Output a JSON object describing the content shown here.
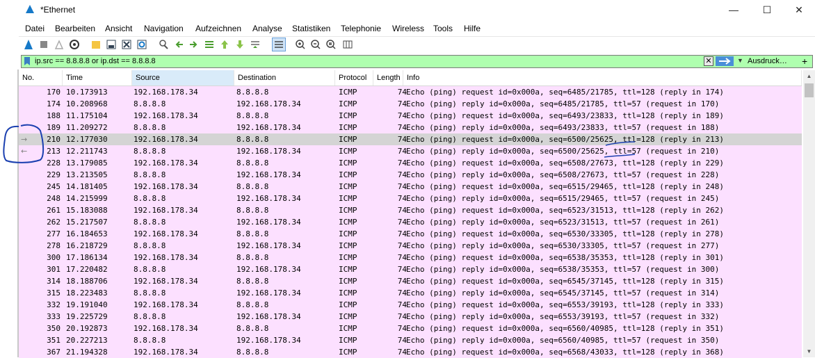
{
  "window": {
    "title": "*Ethernet"
  },
  "menu": [
    "Datei",
    "Bearbeiten",
    "Ansicht",
    "Navigation",
    "Aufzeichnen",
    "Analyse",
    "Statistiken",
    "Telephonie",
    "Wireless",
    "Tools",
    "Hilfe"
  ],
  "filter": {
    "expression": "ip.src == 8.8.8.8 or ip.dst == 8.8.8.8",
    "expression_button": "Ausdruck…",
    "plus": "+"
  },
  "columns": [
    "No.",
    "Time",
    "Source",
    "Destination",
    "Protocol",
    "Length",
    "Info"
  ],
  "selected_row": 4,
  "rows": [
    {
      "no": "170",
      "time": "10.173913",
      "src": "192.168.178.34",
      "dst": "8.8.8.8",
      "proto": "ICMP",
      "len": "74",
      "info": "Echo (ping) request  id=0x000a, seq=6485/21785, ttl=128 (reply in 174)"
    },
    {
      "no": "174",
      "time": "10.208968",
      "src": "8.8.8.8",
      "dst": "192.168.178.34",
      "proto": "ICMP",
      "len": "74",
      "info": "Echo (ping) reply    id=0x000a, seq=6485/21785, ttl=57 (request in 170)"
    },
    {
      "no": "188",
      "time": "11.175104",
      "src": "192.168.178.34",
      "dst": "8.8.8.8",
      "proto": "ICMP",
      "len": "74",
      "info": "Echo (ping) request  id=0x000a, seq=6493/23833, ttl=128 (reply in 189)"
    },
    {
      "no": "189",
      "time": "11.209272",
      "src": "8.8.8.8",
      "dst": "192.168.178.34",
      "proto": "ICMP",
      "len": "74",
      "info": "Echo (ping) reply    id=0x000a, seq=6493/23833, ttl=57 (request in 188)"
    },
    {
      "no": "210",
      "time": "12.177030",
      "src": "192.168.178.34",
      "dst": "8.8.8.8",
      "proto": "ICMP",
      "len": "74",
      "info": "Echo (ping) request  id=0x000a, seq=6500/25625, ttl=128 (reply in 213)",
      "arrow": "→"
    },
    {
      "no": "213",
      "time": "12.211743",
      "src": "8.8.8.8",
      "dst": "192.168.178.34",
      "proto": "ICMP",
      "len": "74",
      "info": "Echo (ping) reply    id=0x000a, seq=6500/25625, ttl=57 (request in 210)",
      "arrow": "←"
    },
    {
      "no": "228",
      "time": "13.179085",
      "src": "192.168.178.34",
      "dst": "8.8.8.8",
      "proto": "ICMP",
      "len": "74",
      "info": "Echo (ping) request  id=0x000a, seq=6508/27673, ttl=128 (reply in 229)"
    },
    {
      "no": "229",
      "time": "13.213505",
      "src": "8.8.8.8",
      "dst": "192.168.178.34",
      "proto": "ICMP",
      "len": "74",
      "info": "Echo (ping) reply    id=0x000a, seq=6508/27673, ttl=57 (request in 228)"
    },
    {
      "no": "245",
      "time": "14.181405",
      "src": "192.168.178.34",
      "dst": "8.8.8.8",
      "proto": "ICMP",
      "len": "74",
      "info": "Echo (ping) request  id=0x000a, seq=6515/29465, ttl=128 (reply in 248)"
    },
    {
      "no": "248",
      "time": "14.215999",
      "src": "8.8.8.8",
      "dst": "192.168.178.34",
      "proto": "ICMP",
      "len": "74",
      "info": "Echo (ping) reply    id=0x000a, seq=6515/29465, ttl=57 (request in 245)"
    },
    {
      "no": "261",
      "time": "15.183088",
      "src": "192.168.178.34",
      "dst": "8.8.8.8",
      "proto": "ICMP",
      "len": "74",
      "info": "Echo (ping) request  id=0x000a, seq=6523/31513, ttl=128 (reply in 262)"
    },
    {
      "no": "262",
      "time": "15.217507",
      "src": "8.8.8.8",
      "dst": "192.168.178.34",
      "proto": "ICMP",
      "len": "74",
      "info": "Echo (ping) reply    id=0x000a, seq=6523/31513, ttl=57 (request in 261)"
    },
    {
      "no": "277",
      "time": "16.184653",
      "src": "192.168.178.34",
      "dst": "8.8.8.8",
      "proto": "ICMP",
      "len": "74",
      "info": "Echo (ping) request  id=0x000a, seq=6530/33305, ttl=128 (reply in 278)"
    },
    {
      "no": "278",
      "time": "16.218729",
      "src": "8.8.8.8",
      "dst": "192.168.178.34",
      "proto": "ICMP",
      "len": "74",
      "info": "Echo (ping) reply    id=0x000a, seq=6530/33305, ttl=57 (request in 277)"
    },
    {
      "no": "300",
      "time": "17.186134",
      "src": "192.168.178.34",
      "dst": "8.8.8.8",
      "proto": "ICMP",
      "len": "74",
      "info": "Echo (ping) request  id=0x000a, seq=6538/35353, ttl=128 (reply in 301)"
    },
    {
      "no": "301",
      "time": "17.220482",
      "src": "8.8.8.8",
      "dst": "192.168.178.34",
      "proto": "ICMP",
      "len": "74",
      "info": "Echo (ping) reply    id=0x000a, seq=6538/35353, ttl=57 (request in 300)"
    },
    {
      "no": "314",
      "time": "18.188706",
      "src": "192.168.178.34",
      "dst": "8.8.8.8",
      "proto": "ICMP",
      "len": "74",
      "info": "Echo (ping) request  id=0x000a, seq=6545/37145, ttl=128 (reply in 315)"
    },
    {
      "no": "315",
      "time": "18.223483",
      "src": "8.8.8.8",
      "dst": "192.168.178.34",
      "proto": "ICMP",
      "len": "74",
      "info": "Echo (ping) reply    id=0x000a, seq=6545/37145, ttl=57 (request in 314)"
    },
    {
      "no": "332",
      "time": "19.191040",
      "src": "192.168.178.34",
      "dst": "8.8.8.8",
      "proto": "ICMP",
      "len": "74",
      "info": "Echo (ping) request  id=0x000a, seq=6553/39193, ttl=128 (reply in 333)"
    },
    {
      "no": "333",
      "time": "19.225729",
      "src": "8.8.8.8",
      "dst": "192.168.178.34",
      "proto": "ICMP",
      "len": "74",
      "info": "Echo (ping) reply    id=0x000a, seq=6553/39193, ttl=57 (request in 332)"
    },
    {
      "no": "350",
      "time": "20.192873",
      "src": "192.168.178.34",
      "dst": "8.8.8.8",
      "proto": "ICMP",
      "len": "74",
      "info": "Echo (ping) request  id=0x000a, seq=6560/40985, ttl=128 (reply in 351)"
    },
    {
      "no": "351",
      "time": "20.227213",
      "src": "8.8.8.8",
      "dst": "192.168.178.34",
      "proto": "ICMP",
      "len": "74",
      "info": "Echo (ping) reply    id=0x000a, seq=6560/40985, ttl=57 (request in 350)"
    },
    {
      "no": "367",
      "time": "21.194328",
      "src": "192.168.178.34",
      "dst": "8.8.8.8",
      "proto": "ICMP",
      "len": "74",
      "info": "Echo (ping) request  id=0x000a, seq=6568/43033, ttl=128 (reply in 368)"
    }
  ],
  "colors": {
    "row_bg": "#fce0ff",
    "selected_bg": "#d4d4d4",
    "filter_ok": "#afffaf",
    "annotation": "#1a3fb0"
  }
}
